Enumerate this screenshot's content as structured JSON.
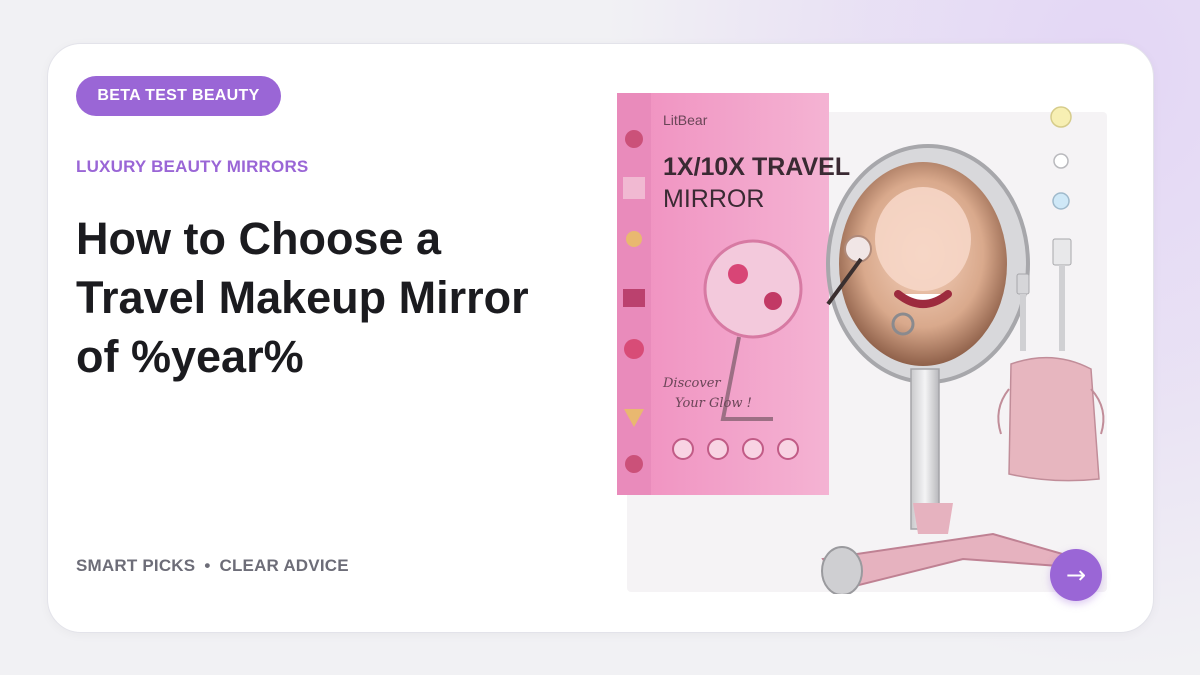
{
  "badge": "BETA TEST BEAUTY",
  "kicker": "LUXURY BEAUTY MIRRORS",
  "headline_lines": [
    "How to Choose a",
    "Travel Makeup Mirror",
    "of %year%"
  ],
  "footer": {
    "tag1": "SMART PICKS",
    "separator": "•",
    "tag2": "CLEAR ADVICE"
  },
  "product": {
    "brand": "LitBear",
    "title_line1": "1X/10X TRAVEL",
    "title_line2": "MIRROR",
    "script_line1": "Discover",
    "script_line2": "Your Glow !",
    "icon": "mirror-product-image"
  },
  "arrow": {
    "icon": "arrow-right-icon",
    "glyph": "→"
  },
  "colors": {
    "accent": "#9a66d6",
    "text": "#1b1b1f",
    "muted": "#6d6d78",
    "box_pink": "#f2a7cf"
  }
}
